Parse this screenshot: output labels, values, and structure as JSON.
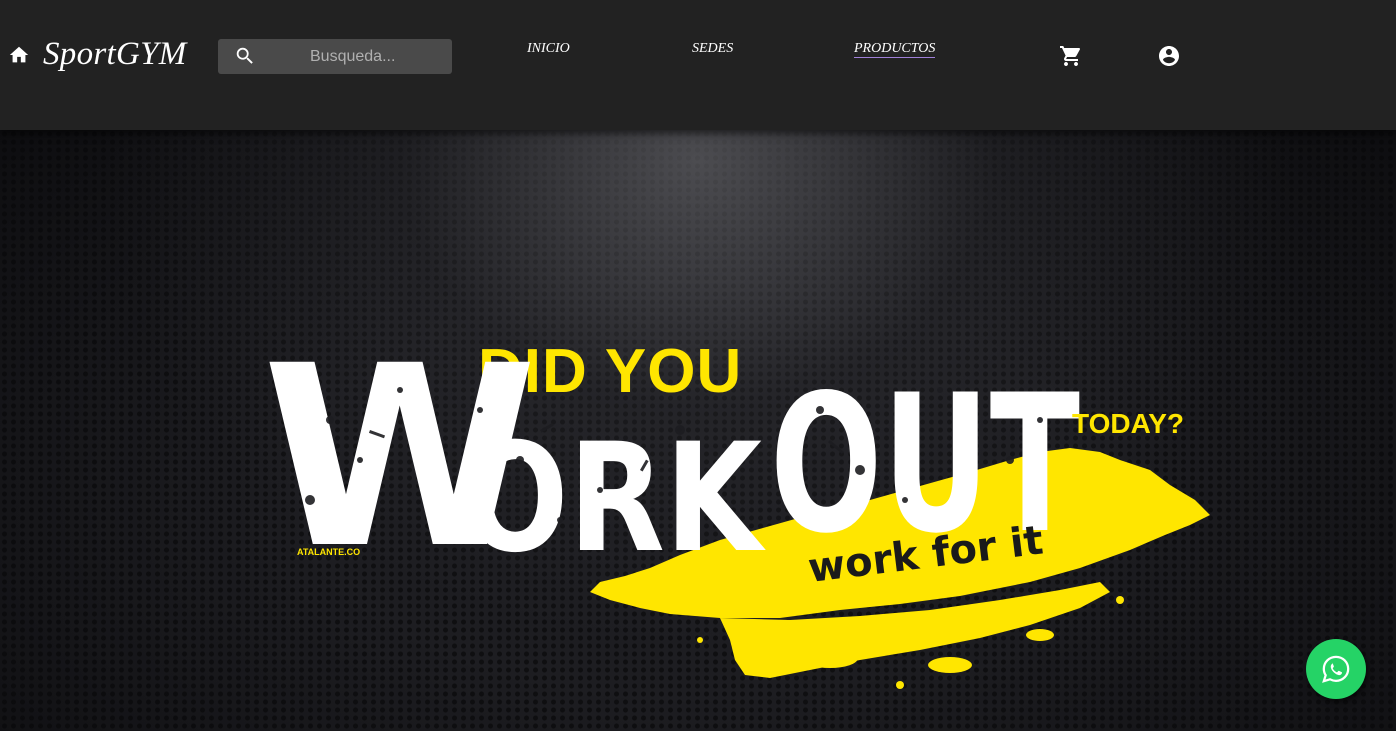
{
  "header": {
    "brand": "SportGYM",
    "home_icon": "home-icon",
    "search": {
      "placeholder": "Busqueda...",
      "value": "",
      "icon": "search-icon"
    },
    "nav": [
      {
        "label": "INICIO"
      },
      {
        "label": "SEDES"
      },
      {
        "label": "PRODUCTOS"
      }
    ],
    "cart_icon": "shopping-cart-icon",
    "account_icon": "account-circle-icon"
  },
  "hero": {
    "line1": "DID YOU",
    "big_w": "W",
    "big_ork": "ORK",
    "big_out": "OUT",
    "today": "TODAY?",
    "slogan": "work for it",
    "credit": "ATALANTE.CO"
  },
  "whatsapp": {
    "icon": "whatsapp-icon"
  },
  "colors": {
    "header_bg": "#222222",
    "accent_yellow": "#ffe600",
    "whatsapp_green": "#25d366",
    "search_bg": "#4a4a4a"
  }
}
